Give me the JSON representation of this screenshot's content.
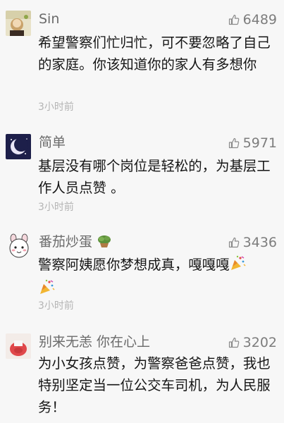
{
  "comments": [
    {
      "name": "Sin",
      "likes": "6489",
      "text": "希望警察们忙归忙，可不要忽略了自己的家庭。你该知道你的家人有多想你",
      "time": "3小时前"
    },
    {
      "name": "简单",
      "likes": "5971",
      "text": "基层没有哪个岗位是轻松的，为基层工作人员点赞 。",
      "time": "3小时前"
    },
    {
      "name": "番茄炒蛋",
      "likes": "3436",
      "text": "警察阿姨愿你梦想成真，嘎嘎嘎",
      "time": "3小时前"
    },
    {
      "name": "别来无恙 你在心上",
      "likes": "3202",
      "text": "为小女孩点赞，为警察爸爸点赞，我也特别坚定当一位公交车司机，为人民服务！",
      "time": ""
    }
  ],
  "icons": {
    "like": "thumbs-up-icon",
    "party": "party-popper-icon",
    "plant": "plant-emoji-icon"
  },
  "colors": {
    "background": "#f7f7f7",
    "name": "#6b6b6b",
    "text": "#151515",
    "meta": "#b4b4b4"
  }
}
